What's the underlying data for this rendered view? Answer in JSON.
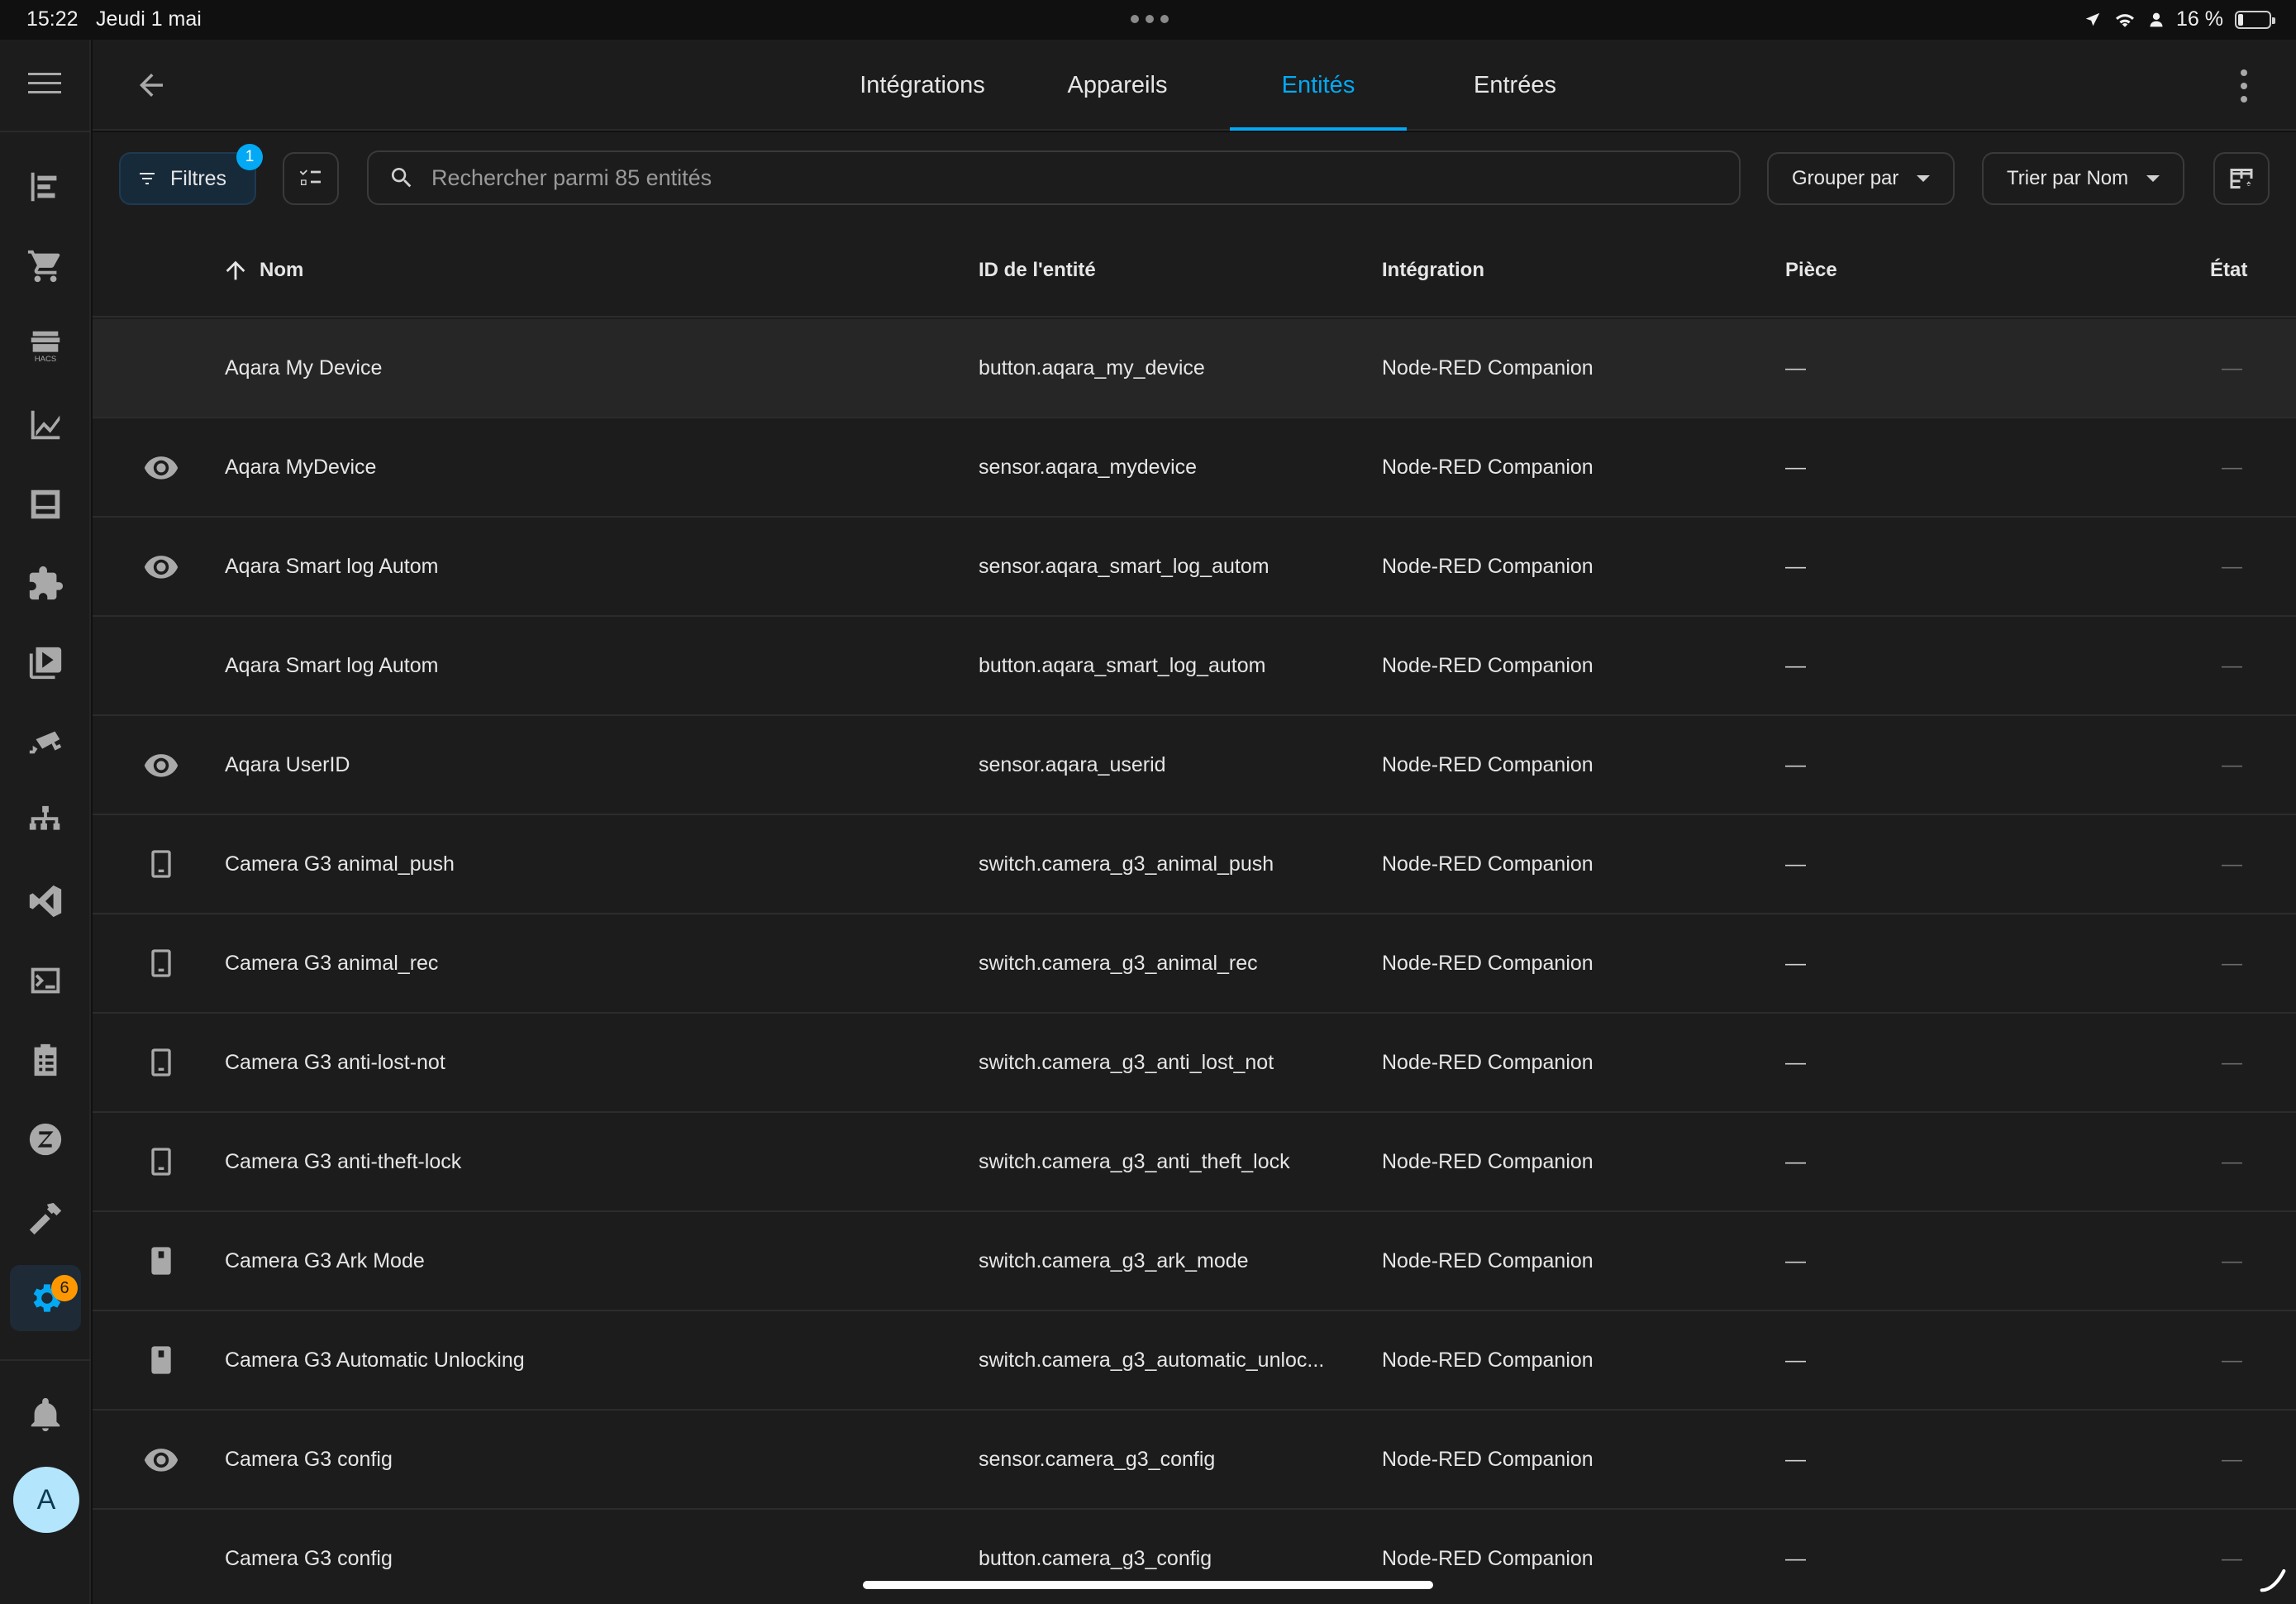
{
  "status_bar": {
    "time": "15:22",
    "date": "Jeudi 1 mai",
    "battery": "16 %",
    "battery_level": 0.16
  },
  "sidebar": {
    "items": [
      {
        "icon": "list-icon"
      },
      {
        "icon": "cart-icon"
      },
      {
        "icon": "hacs-icon",
        "label": "HACS"
      },
      {
        "icon": "chart-icon"
      },
      {
        "icon": "dashboard-icon"
      },
      {
        "icon": "puzzle-icon"
      },
      {
        "icon": "media-icon"
      },
      {
        "icon": "cctv-icon"
      },
      {
        "icon": "network-icon"
      },
      {
        "icon": "vscode-icon"
      },
      {
        "icon": "terminal-icon"
      },
      {
        "icon": "clipboard-icon"
      },
      {
        "icon": "zigbee-icon"
      },
      {
        "icon": "hammer-icon"
      },
      {
        "icon": "settings-icon",
        "badge": "6",
        "active": true
      }
    ],
    "bottom": {
      "notifications_icon": "bell-icon",
      "avatar_letter": "A"
    }
  },
  "header": {
    "tabs": [
      "Intégrations",
      "Appareils",
      "Entités",
      "Entrées"
    ],
    "active_tab": "Entités"
  },
  "toolbar": {
    "filters_label": "Filtres",
    "filters_badge": "1",
    "search_placeholder": "Rechercher parmi 85 entités",
    "group_label": "Grouper par",
    "sort_label": "Trier par Nom"
  },
  "table": {
    "columns": {
      "name": "Nom",
      "entity_id": "ID de l'entité",
      "integration": "Intégration",
      "area": "Pièce",
      "state": "État"
    },
    "rows": [
      {
        "icon": "",
        "name": "Aqara My Device",
        "entity_id": "button.aqara_my_device",
        "integration": "Node-RED Companion",
        "area": "—",
        "state": "—"
      },
      {
        "icon": "eye-icon",
        "name": "Aqara MyDevice",
        "entity_id": "sensor.aqara_mydevice",
        "integration": "Node-RED Companion",
        "area": "—",
        "state": "—"
      },
      {
        "icon": "eye-icon",
        "name": "Aqara Smart log Autom",
        "entity_id": "sensor.aqara_smart_log_autom",
        "integration": "Node-RED Companion",
        "area": "—",
        "state": "—"
      },
      {
        "icon": "",
        "name": "Aqara Smart log Autom",
        "entity_id": "button.aqara_smart_log_autom",
        "integration": "Node-RED Companion",
        "area": "—",
        "state": "—"
      },
      {
        "icon": "eye-icon",
        "name": "Aqara UserID",
        "entity_id": "sensor.aqara_userid",
        "integration": "Node-RED Companion",
        "area": "—",
        "state": "—"
      },
      {
        "icon": "switch-off-icon",
        "name": "Camera G3 animal_push",
        "entity_id": "switch.camera_g3_animal_push",
        "integration": "Node-RED Companion",
        "area": "—",
        "state": "—"
      },
      {
        "icon": "switch-off-icon",
        "name": "Camera G3 animal_rec",
        "entity_id": "switch.camera_g3_animal_rec",
        "integration": "Node-RED Companion",
        "area": "—",
        "state": "—"
      },
      {
        "icon": "switch-off-icon",
        "name": "Camera G3 anti-lost-not",
        "entity_id": "switch.camera_g3_anti_lost_not",
        "integration": "Node-RED Companion",
        "area": "—",
        "state": "—"
      },
      {
        "icon": "switch-off-icon",
        "name": "Camera G3 anti-theft-lock",
        "entity_id": "switch.camera_g3_anti_theft_lock",
        "integration": "Node-RED Companion",
        "area": "—",
        "state": "—"
      },
      {
        "icon": "switch-on-icon",
        "name": "Camera G3 Ark Mode",
        "entity_id": "switch.camera_g3_ark_mode",
        "integration": "Node-RED Companion",
        "area": "—",
        "state": "—"
      },
      {
        "icon": "switch-on-icon",
        "name": "Camera G3 Automatic Unlocking",
        "entity_id": "switch.camera_g3_automatic_unloc...",
        "integration": "Node-RED Companion",
        "area": "—",
        "state": "—"
      },
      {
        "icon": "eye-icon",
        "name": "Camera G3 config",
        "entity_id": "sensor.camera_g3_config",
        "integration": "Node-RED Companion",
        "area": "—",
        "state": "—"
      },
      {
        "icon": "",
        "name": "Camera G3 config",
        "entity_id": "button.camera_g3_config",
        "integration": "Node-RED Companion",
        "area": "—",
        "state": "—"
      }
    ]
  }
}
